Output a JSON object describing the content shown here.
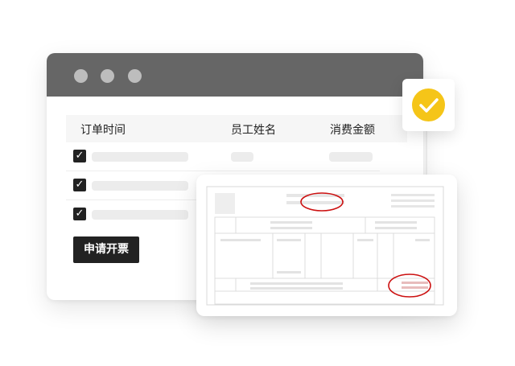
{
  "window": {
    "controls": [
      "window-dot",
      "window-dot",
      "window-dot"
    ]
  },
  "table": {
    "headers": [
      "订单时间",
      "员工姓名",
      "消费金额"
    ],
    "rows": [
      {
        "checked": true
      },
      {
        "checked": true
      },
      {
        "checked": true
      }
    ]
  },
  "apply_button": {
    "label": "申请开票"
  },
  "status": {
    "icon": "checkmark-icon",
    "color": "#f5c518"
  },
  "colors": {
    "titlebar": "#666666",
    "button": "#222222",
    "accent": "#f5c518",
    "highlight": "#cc1111"
  }
}
